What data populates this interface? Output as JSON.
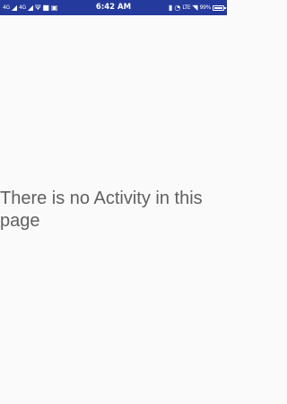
{
  "status_bar": {
    "signal_1": "4G",
    "signal_2": "4G",
    "time": "6:42 AM",
    "lte": "LTE",
    "battery_text": "99%",
    "battery_level": 0.99,
    "icons_left": [
      "signal-icon",
      "signal-icon",
      "usb-icon",
      "video-icon",
      "image-icon"
    ],
    "icons_right": [
      "lock-icon",
      "alarm-icon",
      "wifi-icon",
      "battery-icon"
    ],
    "color": "#243a9c"
  },
  "main": {
    "message": "There is no Activity in this page"
  }
}
